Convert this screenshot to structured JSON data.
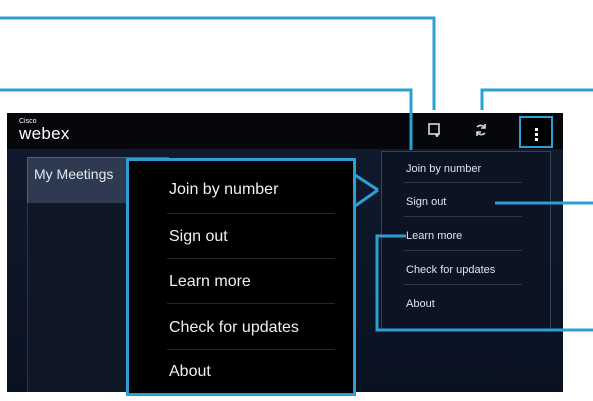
{
  "app": {
    "brand_small": "Cisco",
    "brand": "webex"
  },
  "toolbar": [
    {
      "name": "new-meeting-icon",
      "glyph": "□₊"
    },
    {
      "name": "refresh-icon",
      "glyph": "↻"
    },
    {
      "name": "overflow-menu-icon"
    }
  ],
  "tabs": [
    {
      "label": "My Meetings"
    }
  ],
  "menu_items": [
    "Join by number",
    "Sign out",
    "Learn more",
    "Check for updates",
    "About"
  ],
  "colors": {
    "callout": "#2c9fd6",
    "screen": "#0c1424",
    "menu": "#000000"
  }
}
